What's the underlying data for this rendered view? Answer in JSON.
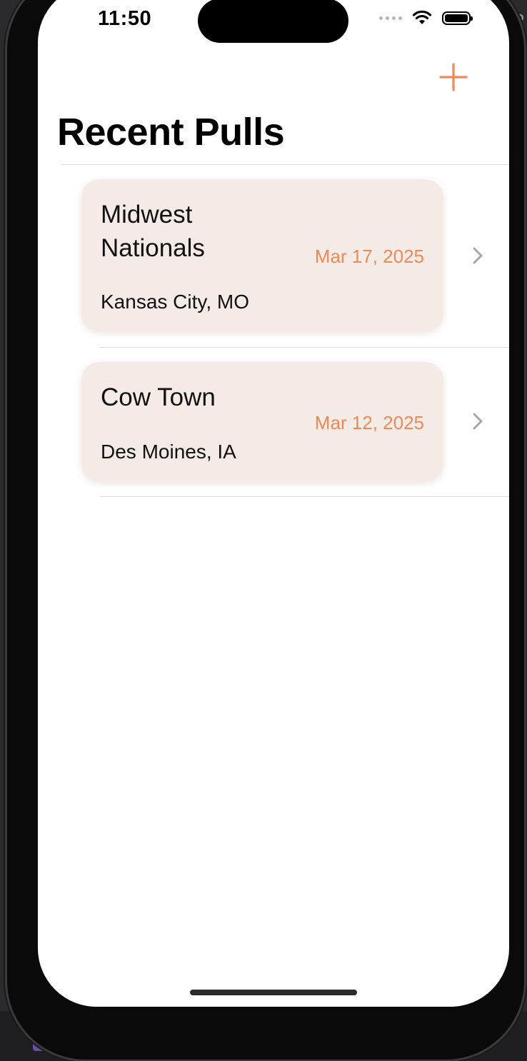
{
  "status_bar": {
    "time": "11:50"
  },
  "backdrop": {
    "corner_text": "ch?"
  },
  "nav": {
    "title": "Recent Pulls",
    "add_icon": "plus-icon"
  },
  "pulls": [
    {
      "name_line1": "Midwest",
      "name_line2": "Nationals",
      "location": "Kansas City, MO",
      "date": "Mar 17, 2025"
    },
    {
      "name_line1": "Cow Town",
      "name_line2": "",
      "location": "Des Moines, IA",
      "date": "Mar 12, 2025"
    }
  ],
  "colors": {
    "accent": "#EE8A58",
    "card_bg": "#F5EBE6"
  }
}
